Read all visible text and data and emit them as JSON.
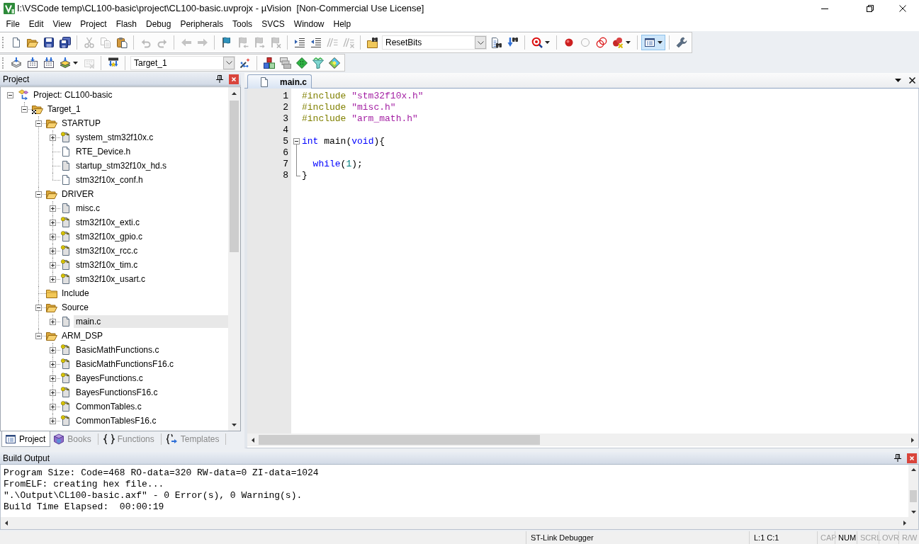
{
  "window": {
    "title": "I:\\VSCode temp\\CL100-basic\\project\\CL100-basic.uvprojx - µVision  [Non-Commercial Use License]"
  },
  "menu": [
    "File",
    "Edit",
    "View",
    "Project",
    "Flash",
    "Debug",
    "Peripherals",
    "Tools",
    "SVCS",
    "Window",
    "Help"
  ],
  "toolbars": [
    {
      "groups": [
        [
          {
            "kind": "new",
            "disabled": false,
            "on": false
          },
          {
            "kind": "open",
            "disabled": false,
            "on": false
          },
          {
            "kind": "save",
            "disabled": false,
            "on": false
          },
          {
            "kind": "saveall",
            "disabled": false,
            "on": false
          }
        ],
        [
          {
            "kind": "cut",
            "disabled": true,
            "on": false
          },
          {
            "kind": "copy",
            "disabled": true,
            "on": false
          },
          {
            "kind": "paste",
            "disabled": false,
            "on": false
          }
        ],
        [
          {
            "kind": "undo",
            "disabled": true,
            "on": false
          },
          {
            "kind": "redo",
            "disabled": true,
            "on": false
          }
        ],
        [
          {
            "kind": "back",
            "disabled": true,
            "on": false
          },
          {
            "kind": "forward",
            "disabled": true,
            "on": false
          }
        ],
        [
          {
            "kind": "bookmark",
            "disabled": false,
            "on": false
          },
          {
            "kind": "bookmarkprev",
            "disabled": true,
            "on": false
          },
          {
            "kind": "bookmarknext",
            "disabled": true,
            "on": false
          },
          {
            "kind": "bookmarkclear",
            "disabled": true,
            "on": false
          }
        ],
        [
          {
            "kind": "indent",
            "disabled": false,
            "on": false
          },
          {
            "kind": "outdent",
            "disabled": false,
            "on": false
          },
          {
            "kind": "comment",
            "disabled": true,
            "on": false
          },
          {
            "kind": "uncomment",
            "disabled": true,
            "on": false
          }
        ],
        [
          {
            "kind": "findfiles",
            "disabled": false,
            "on": false
          },
          {
            "kind": "combo",
            "value": "ResetBits"
          },
          {
            "kind": "find",
            "disabled": false,
            "on": false
          },
          {
            "kind": "incfind",
            "disabled": false,
            "on": false
          }
        ],
        [
          {
            "kind": "debug",
            "disabled": false,
            "on": false,
            "dropdown": true
          }
        ],
        [
          {
            "kind": "breakpoint",
            "disabled": false,
            "on": false
          },
          {
            "kind": "bpenable",
            "disabled": false,
            "on": false
          },
          {
            "kind": "bpdisable",
            "disabled": false,
            "on": false
          },
          {
            "kind": "bpkill",
            "disabled": false,
            "on": false,
            "dropdown": true
          }
        ],
        [
          {
            "kind": "windows",
            "disabled": false,
            "on": true,
            "dropdown": true
          }
        ],
        [
          {
            "kind": "configure",
            "disabled": false,
            "on": false
          }
        ]
      ]
    },
    {
      "groups": [
        [
          {
            "kind": "translate",
            "disabled": false,
            "on": false
          },
          {
            "kind": "build",
            "disabled": false,
            "on": false
          },
          {
            "kind": "rebuild",
            "disabled": false,
            "on": false
          },
          {
            "kind": "batch",
            "disabled": false,
            "on": false,
            "dropdown": true
          },
          {
            "kind": "stop",
            "disabled": true,
            "on": false
          }
        ],
        [
          {
            "kind": "download",
            "disabled": false,
            "on": false
          }
        ],
        [
          {
            "kind": "combo",
            "value": "Target_1"
          },
          {
            "kind": "options",
            "disabled": false,
            "on": false
          }
        ],
        [
          {
            "kind": "blocks",
            "disabled": false,
            "on": false
          },
          {
            "kind": "stack",
            "disabled": false,
            "on": false
          },
          {
            "kind": "gem",
            "disabled": false,
            "on": false
          },
          {
            "kind": "funnel",
            "disabled": false,
            "on": false
          },
          {
            "kind": "gems",
            "disabled": false,
            "on": false
          }
        ]
      ]
    }
  ],
  "project_panel": {
    "title": "Project",
    "tree": [
      {
        "kind": "project",
        "label": "Project: CL100-basic",
        "expanded": true,
        "selected": false,
        "children": [
          {
            "kind": "target",
            "label": "Target_1",
            "expanded": true,
            "selected": false,
            "children": [
              {
                "kind": "folder",
                "label": "STARTUP",
                "expanded": true,
                "selected": false,
                "children": [
                  {
                    "kind": "keyed",
                    "label": "system_stm32f10x.c",
                    "expanded": false,
                    "selected": false
                  },
                  {
                    "kind": "plain",
                    "label": "RTE_Device.h",
                    "selected": false
                  },
                  {
                    "kind": "shaded",
                    "label": "startup_stm32f10x_hd.s",
                    "selected": false
                  },
                  {
                    "kind": "plain",
                    "label": "stm32f10x_conf.h",
                    "selected": false
                  }
                ]
              },
              {
                "kind": "folder",
                "label": "DRIVER",
                "expanded": true,
                "selected": false,
                "children": [
                  {
                    "kind": "shaded",
                    "label": "misc.c",
                    "expanded": false,
                    "selected": false
                  },
                  {
                    "kind": "keyed",
                    "label": "stm32f10x_exti.c",
                    "expanded": false,
                    "selected": false
                  },
                  {
                    "kind": "keyed",
                    "label": "stm32f10x_gpio.c",
                    "expanded": false,
                    "selected": false
                  },
                  {
                    "kind": "keyed",
                    "label": "stm32f10x_rcc.c",
                    "expanded": false,
                    "selected": false
                  },
                  {
                    "kind": "keyed",
                    "label": "stm32f10x_tim.c",
                    "expanded": false,
                    "selected": false
                  },
                  {
                    "kind": "keyed",
                    "label": "stm32f10x_usart.c",
                    "expanded": false,
                    "selected": false
                  }
                ]
              },
              {
                "kind": "folder",
                "label": "Include",
                "selected": false
              },
              {
                "kind": "folder",
                "label": "Source",
                "expanded": true,
                "selected": false,
                "children": [
                  {
                    "kind": "shaded",
                    "label": "main.c",
                    "expanded": false,
                    "selected": true
                  }
                ]
              },
              {
                "kind": "folder",
                "label": "ARM_DSP",
                "expanded": true,
                "selected": false,
                "children": [
                  {
                    "kind": "keyed",
                    "label": "BasicMathFunctions.c",
                    "expanded": false,
                    "selected": false
                  },
                  {
                    "kind": "keyed",
                    "label": "BasicMathFunctionsF16.c",
                    "expanded": false,
                    "selected": false
                  },
                  {
                    "kind": "keyed",
                    "label": "BayesFunctions.c",
                    "expanded": false,
                    "selected": false
                  },
                  {
                    "kind": "keyed",
                    "label": "BayesFunctionsF16.c",
                    "expanded": false,
                    "selected": false
                  },
                  {
                    "kind": "keyed",
                    "label": "CommonTables.c",
                    "expanded": false,
                    "selected": false
                  },
                  {
                    "kind": "keyed",
                    "label": "CommonTablesF16.c",
                    "expanded": false,
                    "selected": false
                  }
                ]
              }
            ]
          }
        ]
      }
    ],
    "tabs": [
      {
        "label": "Project",
        "selected": true
      },
      {
        "label": "Books",
        "selected": false
      },
      {
        "label": "Functions",
        "selected": false
      },
      {
        "label": "Templates",
        "selected": false
      }
    ]
  },
  "editor": {
    "tabs": [
      {
        "label": "main.c",
        "selected": true
      }
    ],
    "lines": [
      {
        "kind": "normal",
        "number": "1",
        "tokens": [
          {
            "kind": "preprocessor",
            "text": "#include "
          },
          {
            "kind": "string",
            "text": "\"stm32f10x.h\""
          }
        ]
      },
      {
        "kind": "normal",
        "number": "2",
        "tokens": [
          {
            "kind": "preprocessor",
            "text": "#include "
          },
          {
            "kind": "string",
            "text": "\"misc.h\""
          }
        ]
      },
      {
        "kind": "normal",
        "number": "3",
        "tokens": [
          {
            "kind": "preprocessor",
            "text": "#include "
          },
          {
            "kind": "string",
            "text": "\"arm_math.h\""
          }
        ]
      },
      {
        "kind": "normal",
        "number": "4"
      },
      {
        "kind": "foldstart",
        "number": "5",
        "expanded": true,
        "tokens": [
          {
            "kind": "keyword",
            "text": "int "
          },
          {
            "kind": "plain",
            "text": "main("
          },
          {
            "kind": "keyword",
            "text": "void"
          },
          {
            "kind": "plain",
            "text": "){"
          }
        ]
      },
      {
        "kind": "foldbody",
        "number": "6"
      },
      {
        "kind": "foldbody",
        "number": "7",
        "tokens": [
          {
            "kind": "keyword",
            "text": "  while"
          },
          {
            "kind": "plain",
            "text": "("
          },
          {
            "kind": "number",
            "text": "1"
          },
          {
            "kind": "plain",
            "text": ");"
          }
        ]
      },
      {
        "kind": "foldend",
        "number": "8",
        "tokens": [
          {
            "kind": "plain",
            "text": "}"
          }
        ]
      }
    ]
  },
  "build_output": {
    "title": "Build Output",
    "lines": [
      "Program Size: Code=468 RO-data=320 RW-data=0 ZI-data=1024",
      "FromELF: creating hex file...",
      "\".\\Output\\CL100-basic.axf\" - 0 Error(s), 0 Warning(s).",
      "Build Time Elapsed:  00:00:19"
    ]
  },
  "status_bar": {
    "debugger": "ST-Link Debugger",
    "position": "L:1 C:1",
    "indicators": [
      {
        "label": "CAP",
        "on": false
      },
      {
        "label": "NUM",
        "on": true
      },
      {
        "label": "SCRL",
        "on": false
      },
      {
        "label": "OVR",
        "on": false
      },
      {
        "label": "R/W",
        "on": false
      }
    ]
  }
}
